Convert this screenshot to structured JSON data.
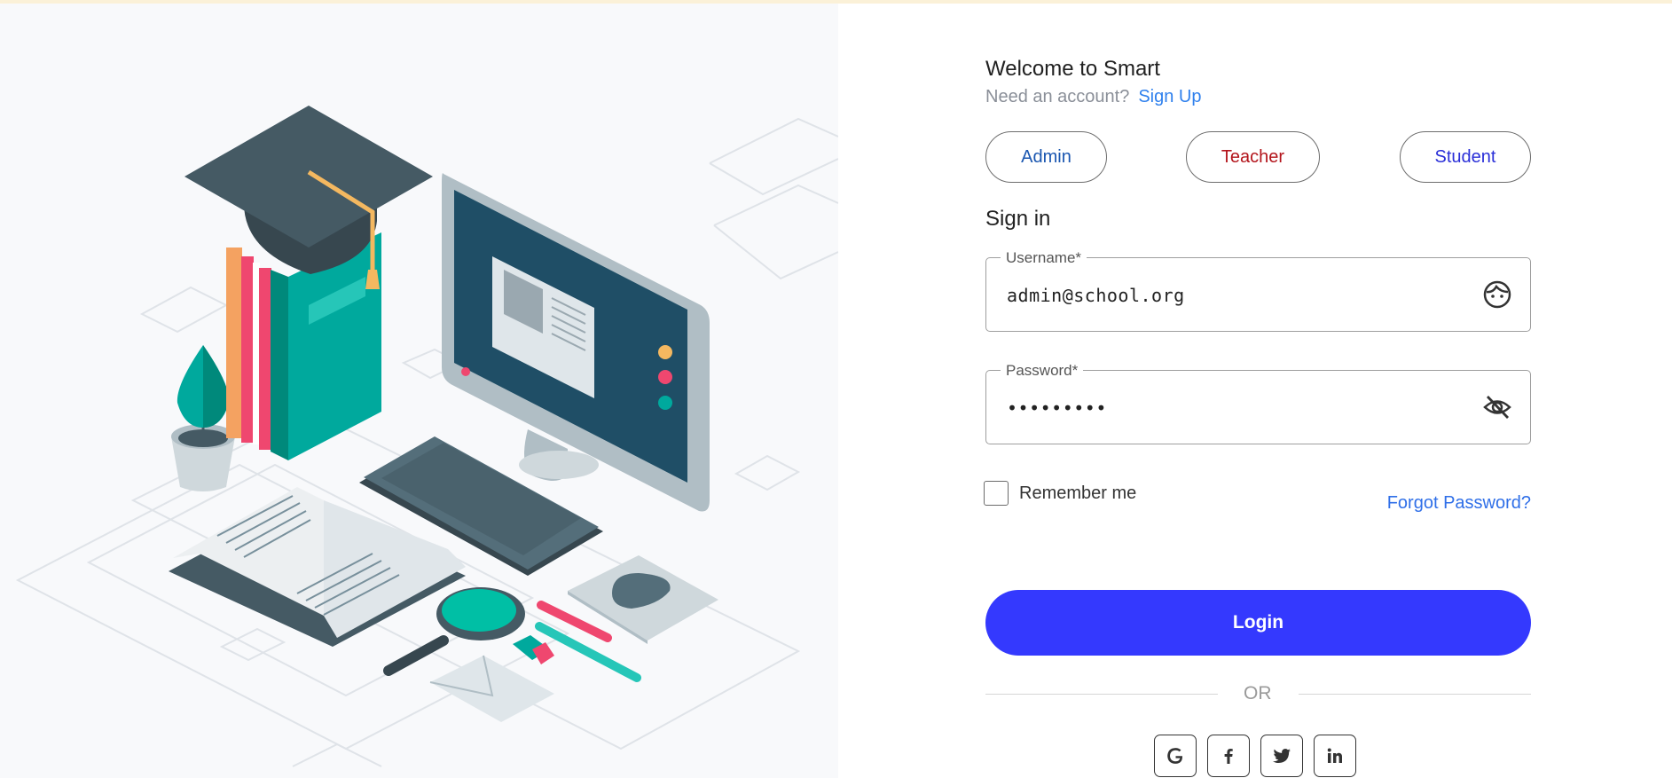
{
  "header": {
    "welcome": "Welcome to Smart",
    "need_account": "Need an account?",
    "signup_link": "Sign Up"
  },
  "roles": [
    {
      "label": "Admin",
      "color": "#1a56b0"
    },
    {
      "label": "Teacher",
      "color": "#b3141b"
    },
    {
      "label": "Student",
      "color": "#2a2fd8"
    }
  ],
  "signin": {
    "title": "Sign in",
    "username_label": "Username*",
    "username_value": "admin@school.org",
    "username_icon": "face-icon",
    "password_label": "Password*",
    "password_value": "•••••••••",
    "password_icon": "eye-off-icon",
    "remember_label": "Remember me",
    "remember_checked": false,
    "forgot_link": "Forgot Password?",
    "login_button": "Login",
    "or_divider": "OR"
  },
  "social": [
    "google-icon",
    "facebook-icon",
    "twitter-icon",
    "linkedin-icon"
  ],
  "colors": {
    "primary": "#3439fe",
    "link": "#2f80ed",
    "illustration_teal": "#00a99d",
    "illustration_dark": "#455a64"
  }
}
